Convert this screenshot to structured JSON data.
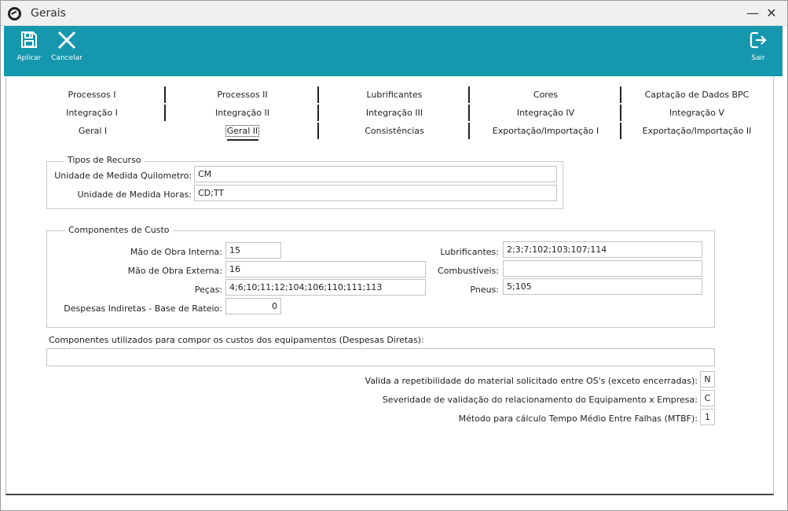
{
  "window": {
    "title": "Gerais"
  },
  "toolbar": {
    "apply_label": "Aplicar",
    "cancel_label": "Cancelar",
    "exit_label": "Sair"
  },
  "tabs": {
    "row1": [
      "Processos I",
      "Processos II",
      "Lubrificantes",
      "Cores",
      "Captação de Dados BPC"
    ],
    "row2": [
      "Integração I",
      "Integração II",
      "Integração III",
      "Integração IV",
      "Integração V"
    ],
    "row3": [
      "Geral I",
      "Geral II",
      "Consistências",
      "Exportação/Importação I",
      "Exportação/Importação II"
    ],
    "active": "Geral II"
  },
  "tipos_recurso": {
    "legend": "Tipos de Recurso",
    "km_label": "Unidade de Medida Quilometro:",
    "km_value": "CM",
    "horas_label": "Unidade de Medida Horas:",
    "horas_value": "CD;TT"
  },
  "componentes_custo": {
    "legend": "Componentes de Custo",
    "mao_interna_label": "Mão de Obra Interna:",
    "mao_interna_value": "15",
    "mao_externa_label": "Mão de Obra Externa:",
    "mao_externa_value": "16",
    "pecas_label": "Peças:",
    "pecas_value": "4;6;10;11;12;104;106;110;111;113",
    "despesas_label": "Despesas Indiretas - Base de Rateio:",
    "despesas_value": "0",
    "lubrificantes_label": "Lubrificantes:",
    "lubrificantes_value": "2;3;7;102;103;107;114",
    "combustiveis_label": "Combustíveis:",
    "combustiveis_value": "",
    "pneus_label": "Pneus:",
    "pneus_value": "5;105"
  },
  "despesas_diretas": {
    "label": "Componentes utilizados para compor os custos dos equipamentos (Despesas Diretas):",
    "value": ""
  },
  "validacoes": {
    "repetibilidade_label": "Valida a repetibilidade do material solicitado entre OS's (exceto encerradas):",
    "repetibilidade_value": "N",
    "severidade_label": "Severidade de validação do relacionamento do Equipamento x Empresa:",
    "severidade_value": "C",
    "mtbf_label": "Método para cálculo Tempo Médio Entre Falhas (MTBF):",
    "mtbf_value": "1"
  },
  "colors": {
    "toolbar": "#1597ad",
    "titlebar": "#f0f0f0"
  },
  "icons": {
    "apply": "save-icon",
    "cancel": "close-x-icon",
    "exit": "exit-icon",
    "app": "app-logo-icon"
  }
}
